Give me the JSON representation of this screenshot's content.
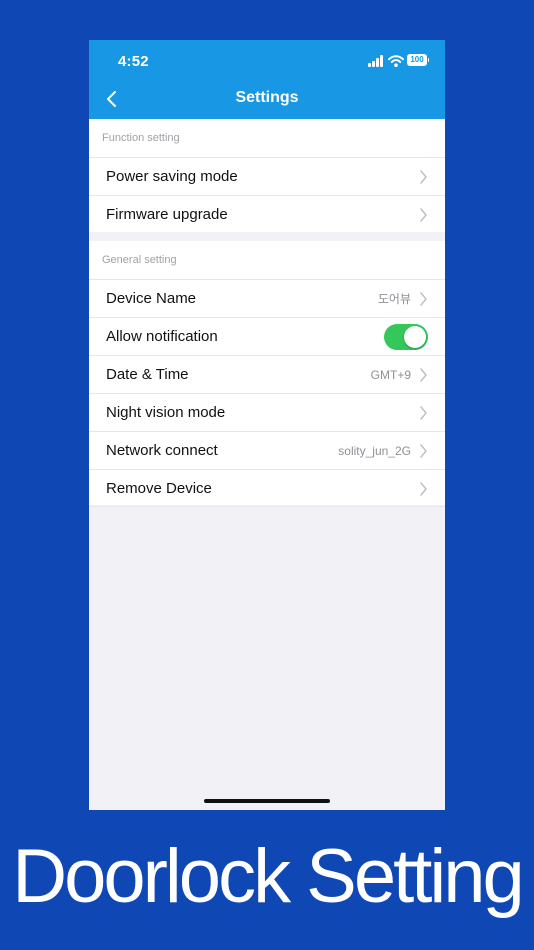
{
  "status_bar": {
    "time": "4:52",
    "battery": "100"
  },
  "header": {
    "title": "Settings",
    "back_icon": "chevron-left-icon"
  },
  "sections": {
    "function": {
      "label": "Function setting",
      "items": [
        {
          "label": "Power saving mode",
          "value": ""
        },
        {
          "label": "Firmware upgrade",
          "value": ""
        }
      ]
    },
    "general": {
      "label": "General setting",
      "items": [
        {
          "label": "Device Name",
          "value": "도어뷰"
        },
        {
          "label": "Allow notification",
          "toggle": true
        },
        {
          "label": "Date & Time",
          "value": "GMT+9"
        },
        {
          "label": "Night vision mode",
          "value": ""
        },
        {
          "label": "Network connect",
          "value": "solity_jun_2G"
        },
        {
          "label": "Remove Device",
          "value": ""
        }
      ]
    }
  },
  "caption": "Doorlock Setting",
  "colors": {
    "background": "#0f47b5",
    "header": "#1898e4",
    "toggle_on": "#35c75a"
  }
}
